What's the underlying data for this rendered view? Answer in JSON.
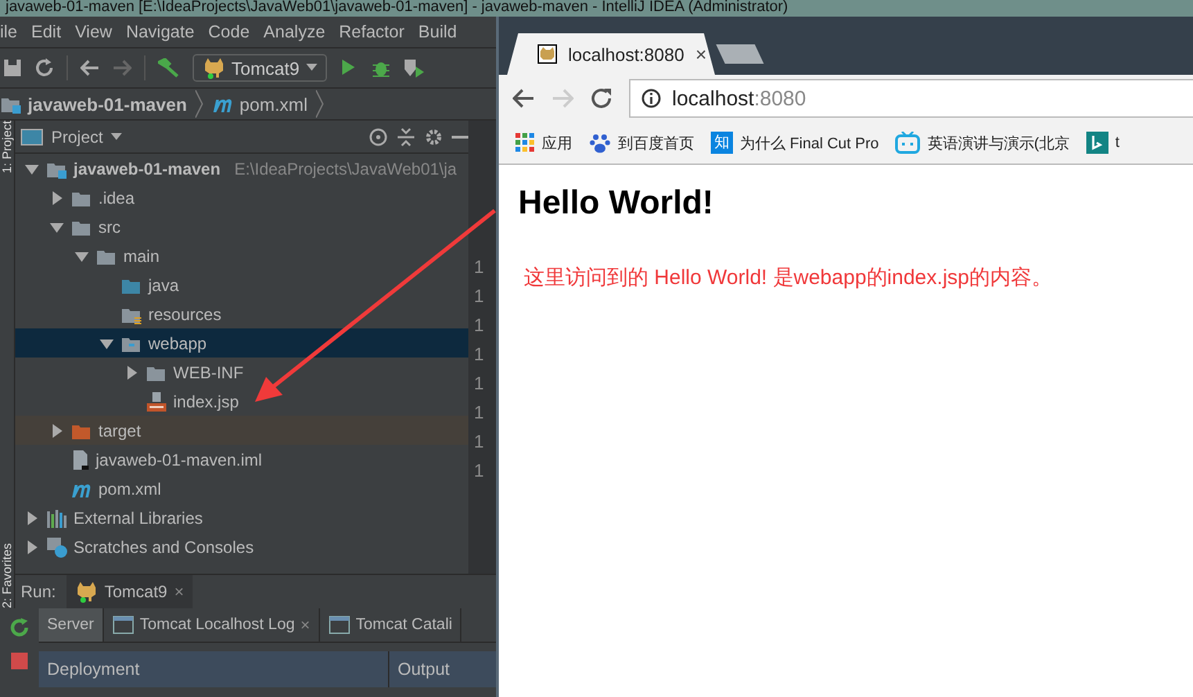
{
  "ide": {
    "title": "javaweb-01-maven [E:\\IdeaProjects\\JavaWeb01\\javaweb-01-maven] - javaweb-maven - IntelliJ IDEA (Administrator)",
    "menu": [
      "ile",
      "Edit",
      "View",
      "Navigate",
      "Code",
      "Analyze",
      "Refactor",
      "Build"
    ],
    "run_config": "Tomcat9",
    "breadcrumbs": [
      {
        "label": "javaweb-01-maven",
        "kind": "module"
      },
      {
        "label": "pom.xml",
        "kind": "maven"
      }
    ],
    "side_tabs": [
      "1: Project",
      "2: Favorites"
    ],
    "project_panel": {
      "title": "Project",
      "tree": [
        {
          "label": "javaweb-01-maven",
          "path": "E:\\IdeaProjects\\JavaWeb01\\ja",
          "kind": "module",
          "expanded": true,
          "selected": false,
          "children": [
            {
              "label": ".idea",
              "kind": "folder",
              "expanded": false,
              "selected": false
            },
            {
              "label": "src",
              "kind": "folder",
              "expanded": true,
              "selected": false,
              "children": [
                {
                  "label": "main",
                  "kind": "folder",
                  "expanded": true,
                  "selected": false,
                  "children": [
                    {
                      "label": "java",
                      "kind": "source",
                      "selected": false
                    },
                    {
                      "label": "resources",
                      "kind": "resources",
                      "selected": false
                    },
                    {
                      "label": "webapp",
                      "kind": "web",
                      "expanded": true,
                      "selected": true,
                      "children": [
                        {
                          "label": "WEB-INF",
                          "kind": "folder",
                          "expanded": false,
                          "selected": false
                        },
                        {
                          "label": "index.jsp",
                          "kind": "jsp",
                          "selected": false
                        }
                      ]
                    }
                  ]
                }
              ]
            },
            {
              "label": "target",
              "kind": "excluded",
              "expanded": false,
              "selected": false
            },
            {
              "label": "javaweb-01-maven.iml",
              "kind": "iml",
              "selected": false
            },
            {
              "label": "pom.xml",
              "kind": "maven",
              "selected": false
            }
          ]
        },
        {
          "label": "External Libraries",
          "kind": "libraries",
          "expanded": false,
          "selected": false
        },
        {
          "label": "Scratches and Consoles",
          "kind": "scratches",
          "expanded": false,
          "selected": false
        }
      ]
    },
    "gutter_numbers": [
      "1",
      "1",
      "1",
      "1",
      "1",
      "1",
      "1",
      "1"
    ],
    "run_panel": {
      "label": "Run:",
      "tab": "Tomcat9",
      "tab_close": "×",
      "tabs": [
        {
          "label": "Server",
          "selected": true
        },
        {
          "label": "Tomcat Localhost Log",
          "selected": false,
          "close": "×"
        },
        {
          "label": "Tomcat Catali",
          "selected": false
        }
      ],
      "columns": [
        "Deployment",
        "Output"
      ]
    }
  },
  "browser": {
    "tab": {
      "title": "localhost:8080",
      "close": "×"
    },
    "url": {
      "host": "localhost",
      "port": ":8080"
    },
    "bookmarks": [
      {
        "label": "应用",
        "kind": "apps"
      },
      {
        "label": "到百度首页",
        "kind": "baidu"
      },
      {
        "label": "为什么 Final Cut Pro",
        "kind": "zhihu",
        "icon": "知"
      },
      {
        "label": "英语演讲与演示(北京",
        "kind": "bilibili"
      },
      {
        "label": "t",
        "kind": "bing"
      }
    ],
    "heading": "Hello World!",
    "note": "这里访问到的 Hello World! 是webapp的index.jsp的内容。"
  }
}
